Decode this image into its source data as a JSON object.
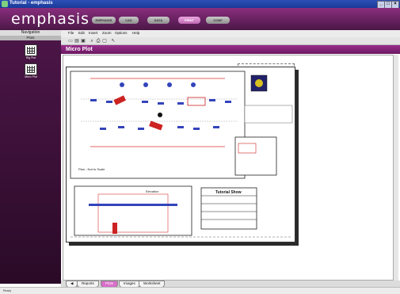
{
  "window": {
    "title": "Tutorial - emphasis"
  },
  "brand": {
    "logo": "emphasis"
  },
  "modules": [
    {
      "label": "EMPHASIS"
    },
    {
      "label": "CAD"
    },
    {
      "label": "DATA"
    },
    {
      "label": "PRINT"
    },
    {
      "label": "CONF"
    }
  ],
  "nav": {
    "header": "Navigation",
    "sub": "Plots",
    "items": [
      {
        "label": "Rig Plot"
      },
      {
        "label": "Micro Plot"
      }
    ]
  },
  "menu": [
    {
      "label": "File"
    },
    {
      "label": "Edit"
    },
    {
      "label": "Insert"
    },
    {
      "label": "Zoom"
    },
    {
      "label": "Options"
    },
    {
      "label": "Help"
    }
  ],
  "panel": {
    "title": "Micro Plot"
  },
  "drawing": {
    "plan_label": "Plan - Not to Scale",
    "elevation_label": "Elevation",
    "title_block_title": "Tutorial Show"
  },
  "tabs": [
    {
      "label": "Reports"
    },
    {
      "label": "Plots"
    },
    {
      "label": "Images"
    },
    {
      "label": "Worksheet"
    }
  ],
  "active_tab": "Plots",
  "status": {
    "left": "Ready"
  }
}
